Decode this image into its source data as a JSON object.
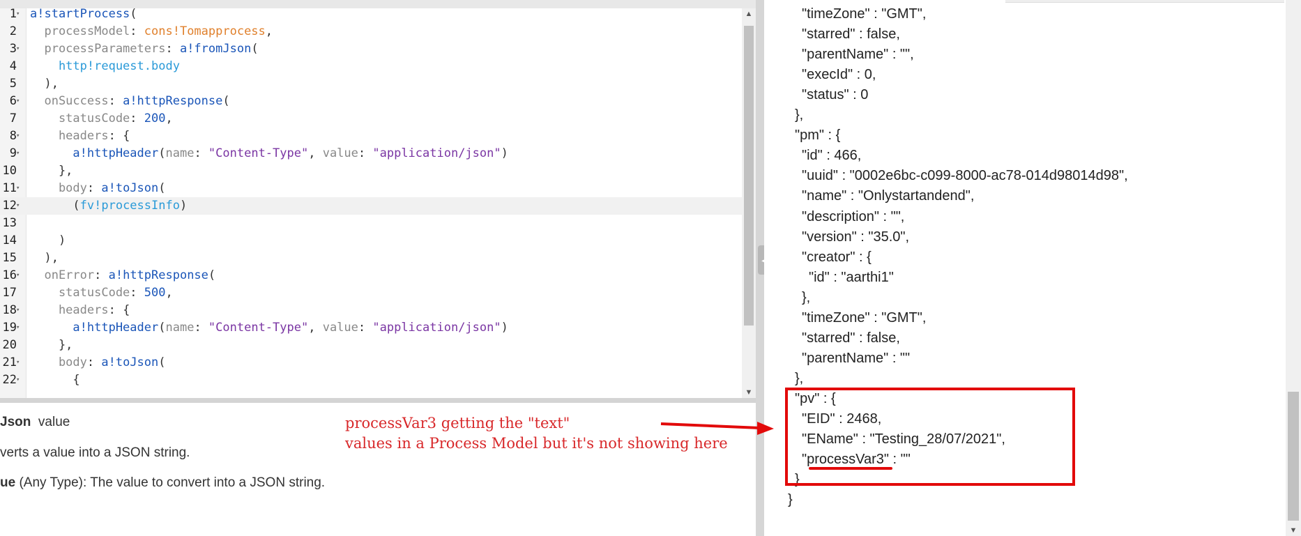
{
  "editor": {
    "lines": [
      {
        "num": "1",
        "fold": true,
        "tokens": [
          {
            "t": "a!startProcess",
            "c": "f"
          },
          {
            "t": "(",
            "c": ""
          }
        ]
      },
      {
        "num": "2",
        "fold": false,
        "tokens": [
          {
            "t": "  processModel",
            "c": "p"
          },
          {
            "t": ": ",
            "c": ""
          },
          {
            "t": "cons!Tomapprocess",
            "c": "c"
          },
          {
            "t": ",",
            "c": ""
          }
        ]
      },
      {
        "num": "3",
        "fold": true,
        "tokens": [
          {
            "t": "  processParameters",
            "c": "p"
          },
          {
            "t": ": ",
            "c": ""
          },
          {
            "t": "a!fromJson",
            "c": "f"
          },
          {
            "t": "(",
            "c": ""
          }
        ]
      },
      {
        "num": "4",
        "fold": false,
        "tokens": [
          {
            "t": "    http!request.body",
            "c": "v"
          }
        ]
      },
      {
        "num": "5",
        "fold": false,
        "tokens": [
          {
            "t": "  ),",
            "c": ""
          }
        ]
      },
      {
        "num": "6",
        "fold": true,
        "tokens": [
          {
            "t": "  onSuccess",
            "c": "p"
          },
          {
            "t": ": ",
            "c": ""
          },
          {
            "t": "a!httpResponse",
            "c": "f"
          },
          {
            "t": "(",
            "c": ""
          }
        ]
      },
      {
        "num": "7",
        "fold": false,
        "tokens": [
          {
            "t": "    statusCode",
            "c": "p"
          },
          {
            "t": ": ",
            "c": ""
          },
          {
            "t": "200",
            "c": "n"
          },
          {
            "t": ",",
            "c": ""
          }
        ]
      },
      {
        "num": "8",
        "fold": true,
        "tokens": [
          {
            "t": "    headers",
            "c": "p"
          },
          {
            "t": ": {",
            "c": ""
          }
        ]
      },
      {
        "num": "9",
        "fold": true,
        "tokens": [
          {
            "t": "      a!httpHeader",
            "c": "f"
          },
          {
            "t": "(",
            "c": ""
          },
          {
            "t": "name",
            "c": "p"
          },
          {
            "t": ": ",
            "c": ""
          },
          {
            "t": "\"Content-Type\"",
            "c": "s"
          },
          {
            "t": ", ",
            "c": ""
          },
          {
            "t": "value",
            "c": "p"
          },
          {
            "t": ": ",
            "c": ""
          },
          {
            "t": "\"application/json\"",
            "c": "s"
          },
          {
            "t": ")",
            "c": ""
          }
        ]
      },
      {
        "num": "10",
        "fold": false,
        "tokens": [
          {
            "t": "    },",
            "c": ""
          }
        ]
      },
      {
        "num": "11",
        "fold": true,
        "tokens": [
          {
            "t": "    body",
            "c": "p"
          },
          {
            "t": ": ",
            "c": ""
          },
          {
            "t": "a!toJson",
            "c": "f"
          },
          {
            "t": "(",
            "c": ""
          }
        ]
      },
      {
        "num": "12",
        "fold": true,
        "active": true,
        "tokens": [
          {
            "t": "      (",
            "c": ""
          },
          {
            "t": "fv!processInfo",
            "c": "v"
          },
          {
            "t": ")",
            "c": ""
          }
        ]
      },
      {
        "num": "13",
        "fold": false,
        "tokens": []
      },
      {
        "num": "14",
        "fold": false,
        "tokens": [
          {
            "t": "    )",
            "c": ""
          }
        ]
      },
      {
        "num": "15",
        "fold": false,
        "tokens": [
          {
            "t": "  ),",
            "c": ""
          }
        ]
      },
      {
        "num": "16",
        "fold": true,
        "tokens": [
          {
            "t": "  onError",
            "c": "p"
          },
          {
            "t": ": ",
            "c": ""
          },
          {
            "t": "a!httpResponse",
            "c": "f"
          },
          {
            "t": "(",
            "c": ""
          }
        ]
      },
      {
        "num": "17",
        "fold": false,
        "tokens": [
          {
            "t": "    statusCode",
            "c": "p"
          },
          {
            "t": ": ",
            "c": ""
          },
          {
            "t": "500",
            "c": "n"
          },
          {
            "t": ",",
            "c": ""
          }
        ]
      },
      {
        "num": "18",
        "fold": true,
        "tokens": [
          {
            "t": "    headers",
            "c": "p"
          },
          {
            "t": ": {",
            "c": ""
          }
        ]
      },
      {
        "num": "19",
        "fold": true,
        "tokens": [
          {
            "t": "      a!httpHeader",
            "c": "f"
          },
          {
            "t": "(",
            "c": ""
          },
          {
            "t": "name",
            "c": "p"
          },
          {
            "t": ": ",
            "c": ""
          },
          {
            "t": "\"Content-Type\"",
            "c": "s"
          },
          {
            "t": ", ",
            "c": ""
          },
          {
            "t": "value",
            "c": "p"
          },
          {
            "t": ": ",
            "c": ""
          },
          {
            "t": "\"application/json\"",
            "c": "s"
          },
          {
            "t": ")",
            "c": ""
          }
        ]
      },
      {
        "num": "20",
        "fold": false,
        "tokens": [
          {
            "t": "    },",
            "c": ""
          }
        ]
      },
      {
        "num": "21",
        "fold": true,
        "tokens": [
          {
            "t": "    body",
            "c": "p"
          },
          {
            "t": ": ",
            "c": ""
          },
          {
            "t": "a!toJson",
            "c": "f"
          },
          {
            "t": "(",
            "c": ""
          }
        ]
      },
      {
        "num": "22",
        "fold": true,
        "tokens": [
          {
            "t": "      {",
            "c": ""
          }
        ]
      }
    ]
  },
  "docs": {
    "signature_name": "Json",
    "signature_param": "value",
    "description": "verts a value into a JSON string.",
    "param_name": "ue",
    "param_desc": " (Any Type): The value to convert into a JSON string."
  },
  "json_lines": [
    "\"timeZone\" : \"GMT\",",
    "\"starred\" : false,",
    "\"parentName\" : \"\",",
    "\"execId\" : 0,",
    "\"status\" : 0",
    "},",
    "\"pm\" : {",
    "\"id\" : 466,",
    "\"uuid\" : \"0002e6bc-c099-8000-ac78-014d98014d98\",",
    "\"name\" : \"Onlystartandend\",",
    "\"description\" : \"\",",
    "\"version\" : \"35.0\",",
    "\"creator\" : {",
    "\"id\" : \"aarthi1\"",
    "},",
    "\"timeZone\" : \"GMT\",",
    "\"starred\" : false,",
    "\"parentName\" : \"\"",
    "},",
    "\"pv\" : {",
    "\"EID\" : 2468,",
    "\"EName\" : \"Testing_28/07/2021\",",
    "\"processVar3\" : \"\"",
    "}",
    "}"
  ],
  "annotation": {
    "line1": "processVar3  getting the \"text\"",
    "line2": "values in a Process Model but it's not showing here"
  },
  "colors": {
    "highlight": "#e20a0a",
    "note_text": "#d8282a"
  }
}
